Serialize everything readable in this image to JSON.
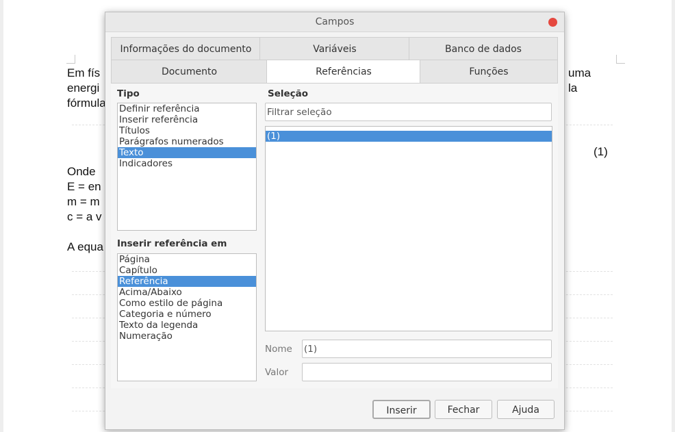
{
  "document": {
    "lines": [
      "Em fís",
      "energi",
      "fórmula",
      "Onde",
      "E = en",
      "m = m",
      "c = a v",
      "A equa"
    ],
    "right_fragments": [
      "uma",
      "la"
    ],
    "equation_number": "(1)"
  },
  "dialog": {
    "title": "Campos",
    "tabs_row1": [
      "Informações do documento",
      "Variáveis",
      "Banco de dados"
    ],
    "tabs_row2": [
      "Documento",
      "Referências",
      "Funções"
    ],
    "active_tab": "Referências",
    "tipo": {
      "label": "Tipo",
      "items": [
        "Definir referência",
        "Inserir referência",
        "Títulos",
        "Parágrafos numerados",
        "Texto",
        "Indicadores"
      ],
      "selected": "Texto"
    },
    "inserir_em": {
      "label": "Inserir referência em",
      "items": [
        "Página",
        "Capítulo",
        "Referência",
        "Acima/Abaixo",
        "Como estilo de página",
        "Categoria e número",
        "Texto da legenda",
        "Numeração"
      ],
      "selected": "Referência"
    },
    "selecao": {
      "label": "Seleção",
      "filter_placeholder": "Filtrar seleção",
      "items": [
        "(1)"
      ],
      "selected": "(1)"
    },
    "nome": {
      "label": "Nome",
      "value": "(1)"
    },
    "valor": {
      "label": "Valor",
      "value": ""
    },
    "buttons": {
      "insert": "Inserir",
      "close": "Fechar",
      "help": "Ajuda"
    }
  }
}
